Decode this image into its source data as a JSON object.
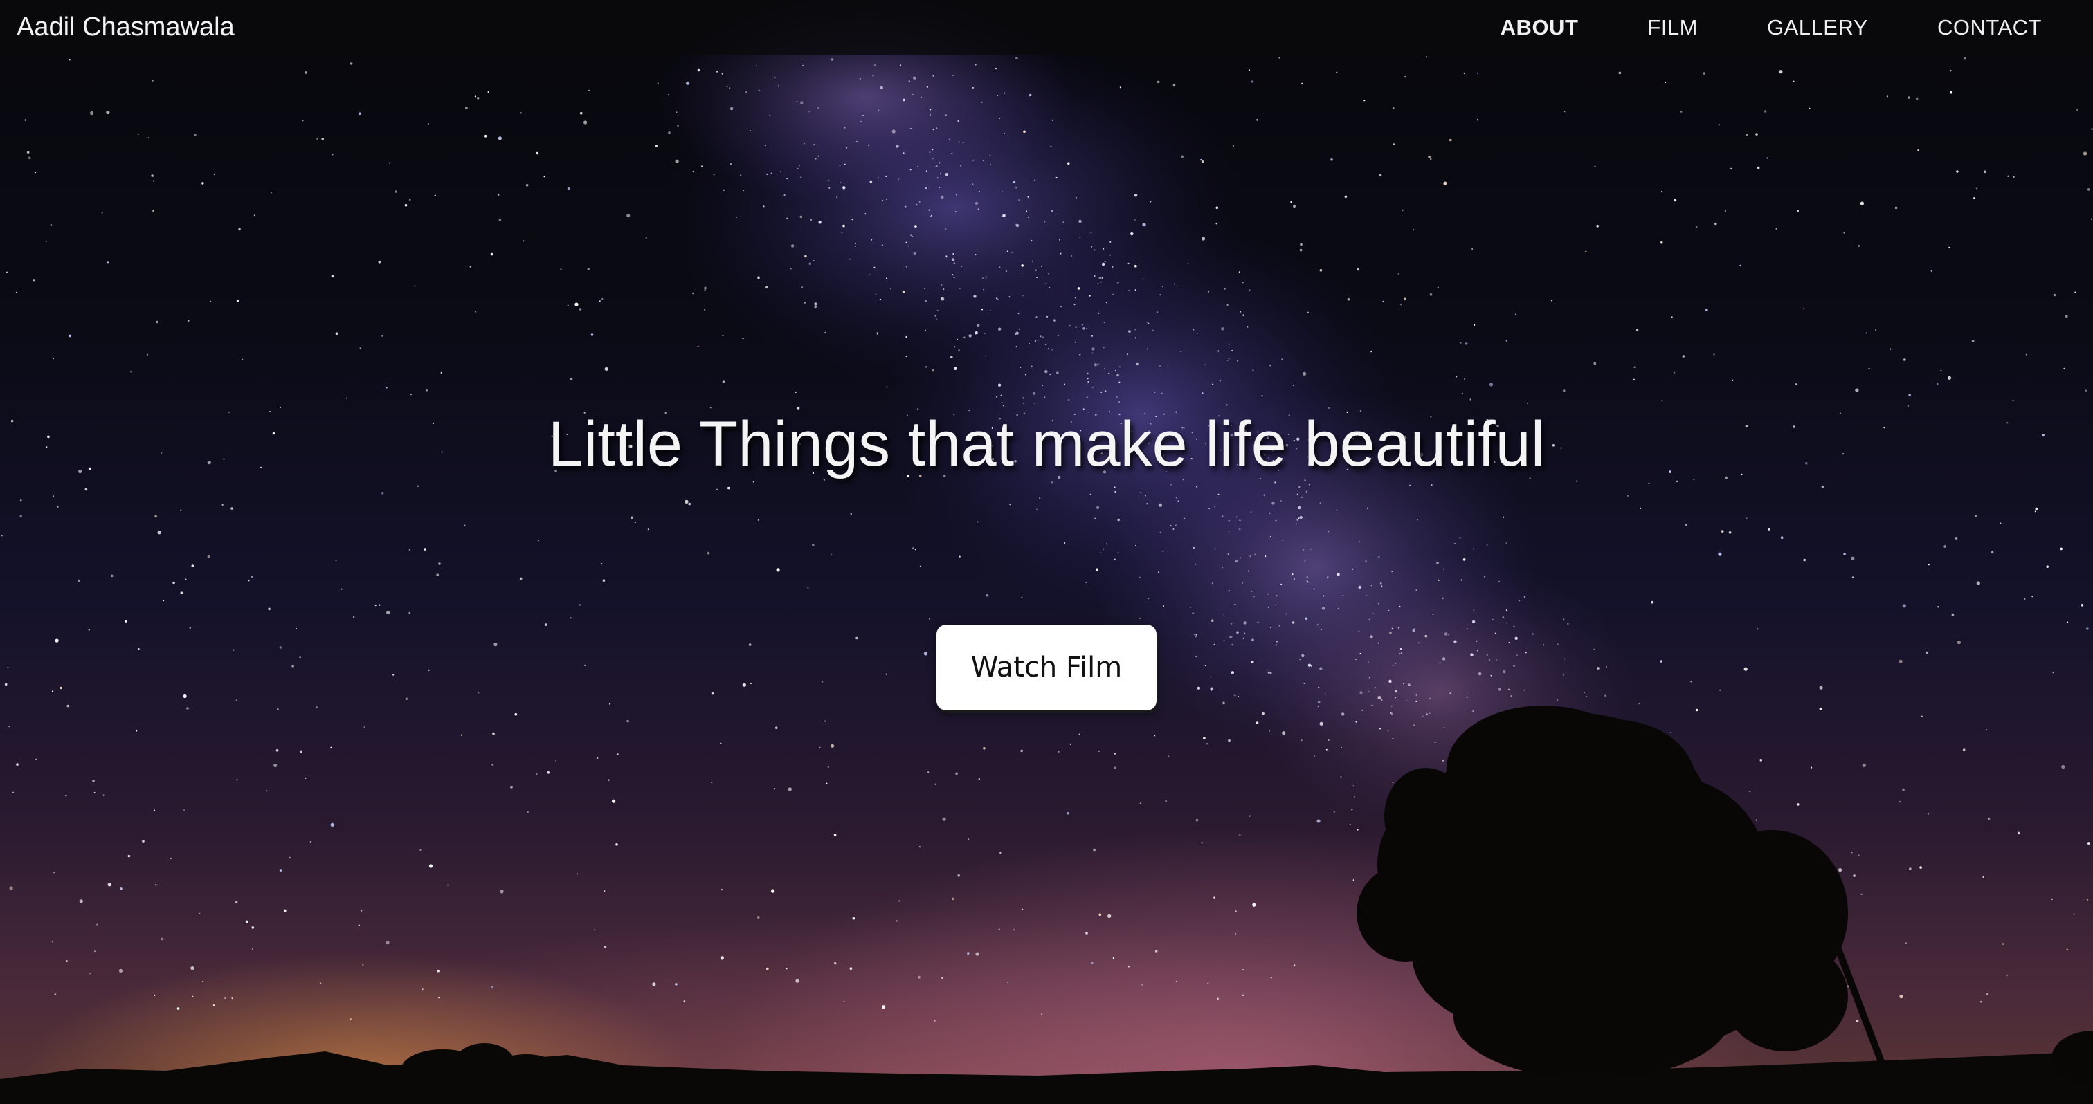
{
  "brand": {
    "name": "Aadil Chasmawala"
  },
  "nav": {
    "items": [
      {
        "label": "ABOUT",
        "active": true
      },
      {
        "label": "FILM",
        "active": false
      },
      {
        "label": "GALLERY",
        "active": false
      },
      {
        "label": "CONTACT",
        "active": false
      }
    ]
  },
  "hero": {
    "title": "Little Things that make life beautiful",
    "button_label": "Watch Film"
  },
  "background": {
    "scene": "night-sky-milky-way-with-tree-silhouette",
    "colors": {
      "sky_top": "#07070c",
      "milky_way": "#5a4aa0",
      "horizon_glow": "#c46e8c",
      "horizon_orange": "#e6963f"
    }
  }
}
